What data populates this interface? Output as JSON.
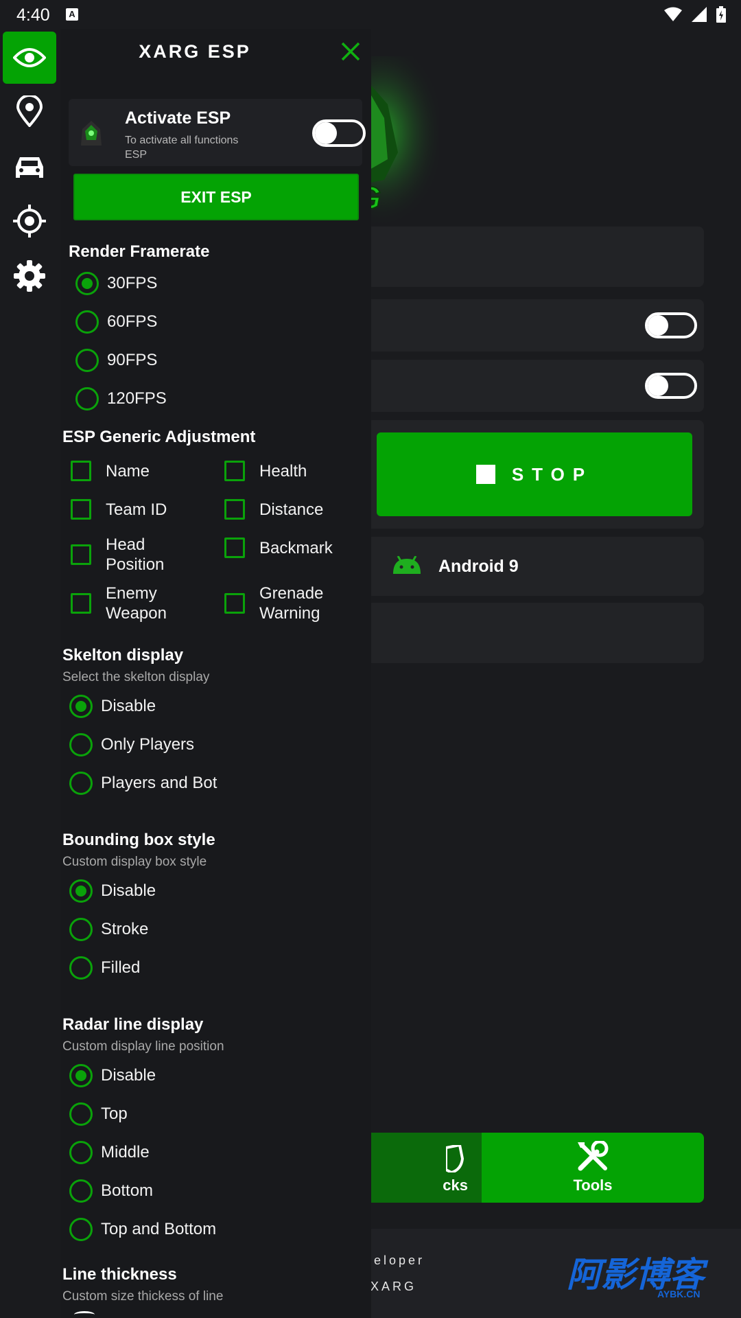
{
  "status_bar": {
    "time": "4:40",
    "left_icon": "A",
    "icons": [
      "wifi-icon",
      "signal-icon",
      "battery-icon"
    ]
  },
  "background_app": {
    "stop_label": "STOP",
    "android_label": "Android 9",
    "tabs": [
      {
        "label": "cks",
        "icon": "shield-icon",
        "selected": false
      },
      {
        "label": "Tools",
        "icon": "tools-icon",
        "selected": true
      }
    ],
    "footer": [
      "veloper",
      "XARG"
    ],
    "watermark": "阿影博客",
    "watermark_sub": "AYBK.CN",
    "logo_text": "RG"
  },
  "rail": {
    "items": [
      {
        "name": "eye-icon",
        "active": true
      },
      {
        "name": "location-icon",
        "active": false
      },
      {
        "name": "car-icon",
        "active": false
      },
      {
        "name": "crosshair-icon",
        "active": false
      },
      {
        "name": "gear-icon",
        "active": false
      }
    ]
  },
  "panel": {
    "title": "XARG ESP",
    "activate": {
      "title": "Activate ESP",
      "subtitle": "To activate all functions ESP",
      "enabled": false
    },
    "exit_label": "EXIT ESP",
    "framerate": {
      "title": "Render Framerate",
      "options": [
        "30FPS",
        "60FPS",
        "90FPS",
        "120FPS"
      ],
      "selected": "30FPS"
    },
    "generic": {
      "title": "ESP Generic Adjustment",
      "items": [
        "Name",
        "Health",
        "Team ID",
        "Distance",
        "Head Position",
        "Backmark",
        "Enemy Weapon",
        "Grenade Warning"
      ]
    },
    "skeleton": {
      "title": "Skelton display",
      "subtitle": "Select the skelton display",
      "options": [
        "Disable",
        "Only Players",
        "Players and Bot"
      ],
      "selected": "Disable"
    },
    "bbox": {
      "title": "Bounding box style",
      "subtitle": "Custom display box style",
      "options": [
        "Disable",
        "Stroke",
        "Filled"
      ],
      "selected": "Disable"
    },
    "radar": {
      "title": "Radar line display",
      "subtitle": "Custom display line position",
      "options": [
        "Disable",
        "Top",
        "Middle",
        "Bottom",
        "Top and Bottom"
      ],
      "selected": "Disable"
    },
    "thickness": {
      "title": "Line thickness",
      "subtitle": "Custom size thickess of line"
    }
  },
  "colors": {
    "accent": "#04a304",
    "panel_bg": "#18191c",
    "card_bg": "#202125",
    "dark_green": "#0b6a0b"
  }
}
